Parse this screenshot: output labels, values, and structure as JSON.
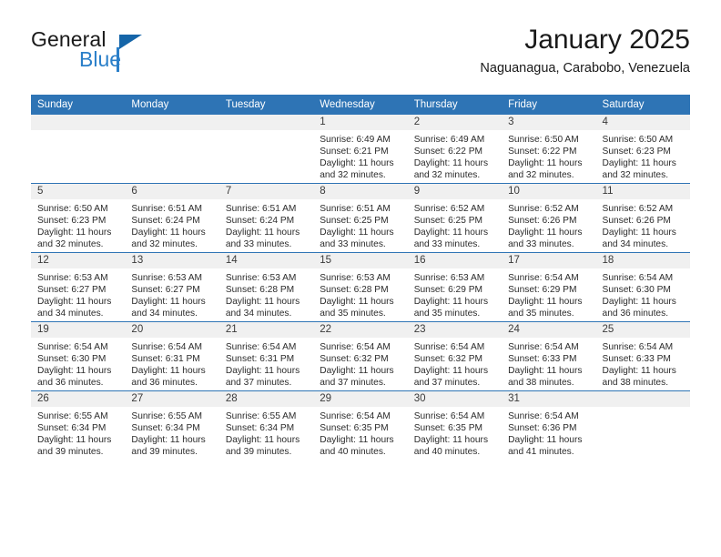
{
  "brand": {
    "word1": "General",
    "word2": "Blue",
    "logo_icon": "triangle-flag-icon",
    "accent_color": "#2a7fc9",
    "dark_color": "#1565a8"
  },
  "header": {
    "month_title": "January 2025",
    "location": "Naguanagua, Carabobo, Venezuela",
    "header_bg": "#2e74b5"
  },
  "calendar": {
    "weekday_headers": [
      "Sunday",
      "Monday",
      "Tuesday",
      "Wednesday",
      "Thursday",
      "Friday",
      "Saturday"
    ],
    "weeks": [
      [
        {
          "day": "",
          "lines": []
        },
        {
          "day": "",
          "lines": []
        },
        {
          "day": "",
          "lines": []
        },
        {
          "day": "1",
          "lines": [
            "Sunrise: 6:49 AM",
            "Sunset: 6:21 PM",
            "Daylight: 11 hours",
            "and 32 minutes."
          ]
        },
        {
          "day": "2",
          "lines": [
            "Sunrise: 6:49 AM",
            "Sunset: 6:22 PM",
            "Daylight: 11 hours",
            "and 32 minutes."
          ]
        },
        {
          "day": "3",
          "lines": [
            "Sunrise: 6:50 AM",
            "Sunset: 6:22 PM",
            "Daylight: 11 hours",
            "and 32 minutes."
          ]
        },
        {
          "day": "4",
          "lines": [
            "Sunrise: 6:50 AM",
            "Sunset: 6:23 PM",
            "Daylight: 11 hours",
            "and 32 minutes."
          ]
        }
      ],
      [
        {
          "day": "5",
          "lines": [
            "Sunrise: 6:50 AM",
            "Sunset: 6:23 PM",
            "Daylight: 11 hours",
            "and 32 minutes."
          ]
        },
        {
          "day": "6",
          "lines": [
            "Sunrise: 6:51 AM",
            "Sunset: 6:24 PM",
            "Daylight: 11 hours",
            "and 32 minutes."
          ]
        },
        {
          "day": "7",
          "lines": [
            "Sunrise: 6:51 AM",
            "Sunset: 6:24 PM",
            "Daylight: 11 hours",
            "and 33 minutes."
          ]
        },
        {
          "day": "8",
          "lines": [
            "Sunrise: 6:51 AM",
            "Sunset: 6:25 PM",
            "Daylight: 11 hours",
            "and 33 minutes."
          ]
        },
        {
          "day": "9",
          "lines": [
            "Sunrise: 6:52 AM",
            "Sunset: 6:25 PM",
            "Daylight: 11 hours",
            "and 33 minutes."
          ]
        },
        {
          "day": "10",
          "lines": [
            "Sunrise: 6:52 AM",
            "Sunset: 6:26 PM",
            "Daylight: 11 hours",
            "and 33 minutes."
          ]
        },
        {
          "day": "11",
          "lines": [
            "Sunrise: 6:52 AM",
            "Sunset: 6:26 PM",
            "Daylight: 11 hours",
            "and 34 minutes."
          ]
        }
      ],
      [
        {
          "day": "12",
          "lines": [
            "Sunrise: 6:53 AM",
            "Sunset: 6:27 PM",
            "Daylight: 11 hours",
            "and 34 minutes."
          ]
        },
        {
          "day": "13",
          "lines": [
            "Sunrise: 6:53 AM",
            "Sunset: 6:27 PM",
            "Daylight: 11 hours",
            "and 34 minutes."
          ]
        },
        {
          "day": "14",
          "lines": [
            "Sunrise: 6:53 AM",
            "Sunset: 6:28 PM",
            "Daylight: 11 hours",
            "and 34 minutes."
          ]
        },
        {
          "day": "15",
          "lines": [
            "Sunrise: 6:53 AM",
            "Sunset: 6:28 PM",
            "Daylight: 11 hours",
            "and 35 minutes."
          ]
        },
        {
          "day": "16",
          "lines": [
            "Sunrise: 6:53 AM",
            "Sunset: 6:29 PM",
            "Daylight: 11 hours",
            "and 35 minutes."
          ]
        },
        {
          "day": "17",
          "lines": [
            "Sunrise: 6:54 AM",
            "Sunset: 6:29 PM",
            "Daylight: 11 hours",
            "and 35 minutes."
          ]
        },
        {
          "day": "18",
          "lines": [
            "Sunrise: 6:54 AM",
            "Sunset: 6:30 PM",
            "Daylight: 11 hours",
            "and 36 minutes."
          ]
        }
      ],
      [
        {
          "day": "19",
          "lines": [
            "Sunrise: 6:54 AM",
            "Sunset: 6:30 PM",
            "Daylight: 11 hours",
            "and 36 minutes."
          ]
        },
        {
          "day": "20",
          "lines": [
            "Sunrise: 6:54 AM",
            "Sunset: 6:31 PM",
            "Daylight: 11 hours",
            "and 36 minutes."
          ]
        },
        {
          "day": "21",
          "lines": [
            "Sunrise: 6:54 AM",
            "Sunset: 6:31 PM",
            "Daylight: 11 hours",
            "and 37 minutes."
          ]
        },
        {
          "day": "22",
          "lines": [
            "Sunrise: 6:54 AM",
            "Sunset: 6:32 PM",
            "Daylight: 11 hours",
            "and 37 minutes."
          ]
        },
        {
          "day": "23",
          "lines": [
            "Sunrise: 6:54 AM",
            "Sunset: 6:32 PM",
            "Daylight: 11 hours",
            "and 37 minutes."
          ]
        },
        {
          "day": "24",
          "lines": [
            "Sunrise: 6:54 AM",
            "Sunset: 6:33 PM",
            "Daylight: 11 hours",
            "and 38 minutes."
          ]
        },
        {
          "day": "25",
          "lines": [
            "Sunrise: 6:54 AM",
            "Sunset: 6:33 PM",
            "Daylight: 11 hours",
            "and 38 minutes."
          ]
        }
      ],
      [
        {
          "day": "26",
          "lines": [
            "Sunrise: 6:55 AM",
            "Sunset: 6:34 PM",
            "Daylight: 11 hours",
            "and 39 minutes."
          ]
        },
        {
          "day": "27",
          "lines": [
            "Sunrise: 6:55 AM",
            "Sunset: 6:34 PM",
            "Daylight: 11 hours",
            "and 39 minutes."
          ]
        },
        {
          "day": "28",
          "lines": [
            "Sunrise: 6:55 AM",
            "Sunset: 6:34 PM",
            "Daylight: 11 hours",
            "and 39 minutes."
          ]
        },
        {
          "day": "29",
          "lines": [
            "Sunrise: 6:54 AM",
            "Sunset: 6:35 PM",
            "Daylight: 11 hours",
            "and 40 minutes."
          ]
        },
        {
          "day": "30",
          "lines": [
            "Sunrise: 6:54 AM",
            "Sunset: 6:35 PM",
            "Daylight: 11 hours",
            "and 40 minutes."
          ]
        },
        {
          "day": "31",
          "lines": [
            "Sunrise: 6:54 AM",
            "Sunset: 6:36 PM",
            "Daylight: 11 hours",
            "and 41 minutes."
          ]
        },
        {
          "day": "",
          "lines": []
        }
      ]
    ]
  }
}
